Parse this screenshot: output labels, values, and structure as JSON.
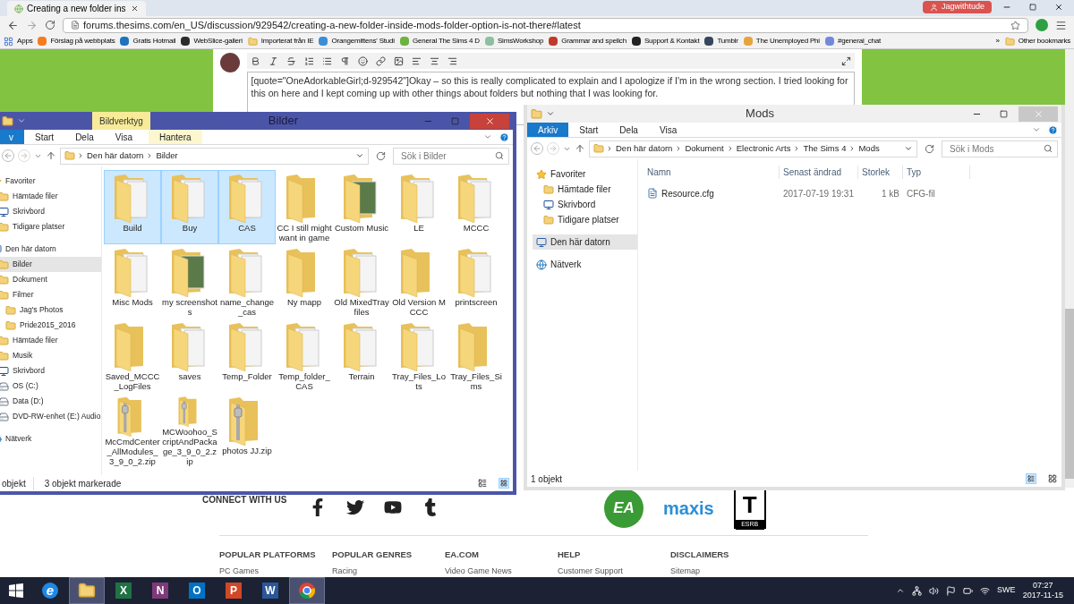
{
  "browser": {
    "tab": {
      "title": "Creating a new folder ins"
    },
    "profile": "Jagwithtude",
    "url": "forums.thesims.com/en_US/discussion/929542/creating-a-new-folder-inside-mods-folder-option-is-not-there#latest",
    "bookmarks": [
      {
        "kind": "apps",
        "label": "Apps"
      },
      {
        "kind": "site",
        "label": "Förslag på webbplats",
        "color": "#f47b20"
      },
      {
        "kind": "site",
        "label": "Gratis Hotmail",
        "color": "#1e73be"
      },
      {
        "kind": "site",
        "label": "WebSlice-galleri",
        "color": "#2b2b2b"
      },
      {
        "kind": "folder",
        "label": "Importerat från IE"
      },
      {
        "kind": "site",
        "label": "Orangemittens' Studi",
        "color": "#3a8fd6"
      },
      {
        "kind": "site",
        "label": "General The Sims 4 D",
        "color": "#6cb33f"
      },
      {
        "kind": "site",
        "label": "SimsWorkshop",
        "color": "#8cc0a0"
      },
      {
        "kind": "site",
        "label": "Grammar and spellch",
        "color": "#c0392b"
      },
      {
        "kind": "site",
        "label": "Support & Kontakt",
        "color": "#222222"
      },
      {
        "kind": "site",
        "label": "Tumblr",
        "color": "#36465d"
      },
      {
        "kind": "site",
        "label": "The Unemployed Phi",
        "color": "#e8a33d"
      },
      {
        "kind": "site",
        "label": "#general_chat",
        "color": "#7289da"
      },
      {
        "kind": "more",
        "label": "»"
      },
      {
        "kind": "folder",
        "label": "Other bookmarks"
      }
    ]
  },
  "post": {
    "text": "[quote=\"OneAdorkableGirl;d-929542\"]Okay – so this is really complicated to explain and I apologize if I'm in the wrong section. I tried looking for this on here and I kept coming up with other things about folders but nothing that I was looking for."
  },
  "windows": [
    {
      "title": "Bilder",
      "active": true,
      "ribbon": [
        {
          "kind": "file",
          "label": "v",
          "selected": false
        },
        {
          "kind": "tab",
          "label": "Start",
          "selected": false
        },
        {
          "kind": "tab",
          "label": "Dela",
          "selected": false
        },
        {
          "kind": "tab",
          "label": "Visa",
          "selected": false
        },
        {
          "kind": "context",
          "label": "Hantera",
          "group": "Bildverktyg",
          "selected": false
        }
      ],
      "path": [
        "Den här datorn",
        "Bilder"
      ],
      "search": {
        "placeholder": "Sök i Bilder"
      },
      "nav": [
        {
          "label": "Favoriter",
          "kind": "favorites",
          "selected": false,
          "children": [
            {
              "label": "Hämtade filer",
              "kind": "folder",
              "selected": false
            },
            {
              "label": "Skrivbord",
              "kind": "desktop",
              "selected": false
            },
            {
              "label": "Tidigare platser",
              "kind": "folder",
              "selected": false
            }
          ]
        },
        {
          "label": "Den här datorn",
          "kind": "computer",
          "selected": false,
          "children": [
            {
              "label": "Bilder",
              "kind": "folder",
              "selected": true
            },
            {
              "label": "Dokument",
              "kind": "folder",
              "selected": false
            },
            {
              "label": "Filmer",
              "kind": "folder",
              "selected": false,
              "children": [
                {
                  "label": "Jag's Photos",
                  "kind": "folder",
                  "selected": false
                },
                {
                  "label": "Pride2015_2016",
                  "kind": "folder",
                  "selected": false
                }
              ]
            },
            {
              "label": "Hämtade filer",
              "kind": "folder",
              "selected": false
            },
            {
              "label": "Musik",
              "kind": "folder",
              "selected": false
            },
            {
              "label": "Skrivbord",
              "kind": "desktop",
              "selected": false
            },
            {
              "label": "OS (C:)",
              "kind": "drive",
              "selected": false
            },
            {
              "label": "Data (D:)",
              "kind": "drive",
              "selected": false
            },
            {
              "label": "DVD-RW-enhet (E:) Audio",
              "kind": "drive",
              "selected": false
            }
          ]
        },
        {
          "label": "Nätverk",
          "kind": "network",
          "selected": false
        }
      ],
      "kind": "icons",
      "items": [
        {
          "name": "Build",
          "kind": "docs",
          "selected": true
        },
        {
          "name": "Buy",
          "kind": "docs",
          "selected": true
        },
        {
          "name": "CAS",
          "kind": "docs",
          "selected": true
        },
        {
          "name": "CC I still might want in game",
          "kind": "folder",
          "selected": false
        },
        {
          "name": "Custom Music",
          "kind": "photo",
          "selected": false
        },
        {
          "name": "LE",
          "kind": "docs",
          "selected": false
        },
        {
          "name": "MCCC",
          "kind": "docs",
          "selected": false
        },
        {
          "name": "Misc Mods",
          "kind": "docs",
          "selected": false
        },
        {
          "name": "my screenshots",
          "kind": "photo",
          "selected": false
        },
        {
          "name": "name_change_cas",
          "kind": "docs",
          "selected": false
        },
        {
          "name": "Ny mapp",
          "kind": "folder",
          "selected": false
        },
        {
          "name": "Old MixedTray files",
          "kind": "docs",
          "selected": false
        },
        {
          "name": "Old Version MCCC",
          "kind": "folder",
          "selected": false
        },
        {
          "name": "printscreen",
          "kind": "docs",
          "selected": false
        },
        {
          "name": "Saved_MCCC_LogFiles",
          "kind": "folder",
          "selected": false
        },
        {
          "name": "saves",
          "kind": "docs",
          "selected": false
        },
        {
          "name": "Temp_Folder",
          "kind": "docs",
          "selected": false
        },
        {
          "name": "Temp_folder_CAS",
          "kind": "docs",
          "selected": false
        },
        {
          "name": "Terrain",
          "kind": "docs",
          "selected": false
        },
        {
          "name": "Tray_Files_Lots",
          "kind": "docs",
          "selected": false
        },
        {
          "name": "Tray_Files_Sims",
          "kind": "folder",
          "selected": false
        },
        {
          "name": "McCmdCenter_AllModules_3_9_0_2.zip",
          "kind": "zip",
          "selected": false
        },
        {
          "name": "MCWoohoo_ScriptAndPackage_3_9_0_2.zip",
          "kind": "zip",
          "selected": false
        },
        {
          "name": "photos JJ.zip",
          "kind": "zip",
          "selected": false
        }
      ],
      "status": [
        "objekt",
        "3 objekt markerade"
      ]
    },
    {
      "title": "Mods",
      "active": false,
      "ribbon": [
        {
          "kind": "file",
          "label": "Arkiv",
          "selected": false
        },
        {
          "kind": "tab",
          "label": "Start",
          "selected": false
        },
        {
          "kind": "tab",
          "label": "Dela",
          "selected": false
        },
        {
          "kind": "tab",
          "label": "Visa",
          "selected": false
        }
      ],
      "path": [
        "Den här datorn",
        "Dokument",
        "Electronic Arts",
        "The Sims 4",
        "Mods"
      ],
      "search": {
        "placeholder": "Sök i Mods"
      },
      "nav": [
        {
          "label": "Favoriter",
          "kind": "favorites",
          "selected": false,
          "children": [
            {
              "label": "Hämtade filer",
              "kind": "folder",
              "selected": false
            },
            {
              "label": "Skrivbord",
              "kind": "desktop",
              "selected": false
            },
            {
              "label": "Tidigare platser",
              "kind": "folder",
              "selected": false
            }
          ]
        },
        {
          "label": "Den här datorn",
          "kind": "computer",
          "selected": true
        },
        {
          "label": "Nätverk",
          "kind": "network",
          "selected": false
        }
      ],
      "kind": "details",
      "columns": [
        "Namn",
        "Senast ändrad",
        "Storlek",
        "Typ"
      ],
      "rows": [
        {
          "cells": [
            "Resource.cfg",
            "2017-07-19 19:31",
            "1 kB",
            "CFG-fil"
          ]
        }
      ],
      "status": [
        "1 objekt"
      ]
    }
  ],
  "footer": {
    "connect": "CONNECT WITH US",
    "social": [
      {
        "kind": "facebook"
      },
      {
        "kind": "twitter"
      },
      {
        "kind": "youtube"
      },
      {
        "kind": "tumblr"
      }
    ],
    "logos": [
      {
        "kind": "ea",
        "text": "EA"
      },
      {
        "kind": "maxis",
        "text": "maxis"
      },
      {
        "kind": "esrb",
        "text": "T",
        "sub": "ESRB"
      }
    ],
    "columns": [
      {
        "heading": "POPULAR PLATFORMS",
        "link": "PC Games"
      },
      {
        "heading": "POPULAR GENRES",
        "link": "Racing"
      },
      {
        "heading": "EA.COM",
        "link": "Video Game News"
      },
      {
        "heading": "HELP",
        "link": "Customer Support"
      },
      {
        "heading": "DISCLAIMERS",
        "link": "Sitemap"
      }
    ]
  },
  "taskbar": {
    "apps": [
      {
        "kind": "ie",
        "letter": "e",
        "color": "#1e88e5",
        "selected": false
      },
      {
        "kind": "explorer",
        "selected": true
      },
      {
        "kind": "office",
        "letter": "X",
        "color": "#1f7244",
        "selected": false
      },
      {
        "kind": "office",
        "letter": "N",
        "color": "#80397b",
        "selected": false
      },
      {
        "kind": "office",
        "letter": "O",
        "color": "#0072c6",
        "selected": false
      },
      {
        "kind": "office",
        "letter": "P",
        "color": "#d24726",
        "selected": false
      },
      {
        "kind": "office",
        "letter": "W",
        "color": "#2b579a",
        "selected": false
      },
      {
        "kind": "chrome",
        "selected": true
      }
    ],
    "language": "SWE",
    "time": "07:27",
    "date": "2017-11-15"
  }
}
